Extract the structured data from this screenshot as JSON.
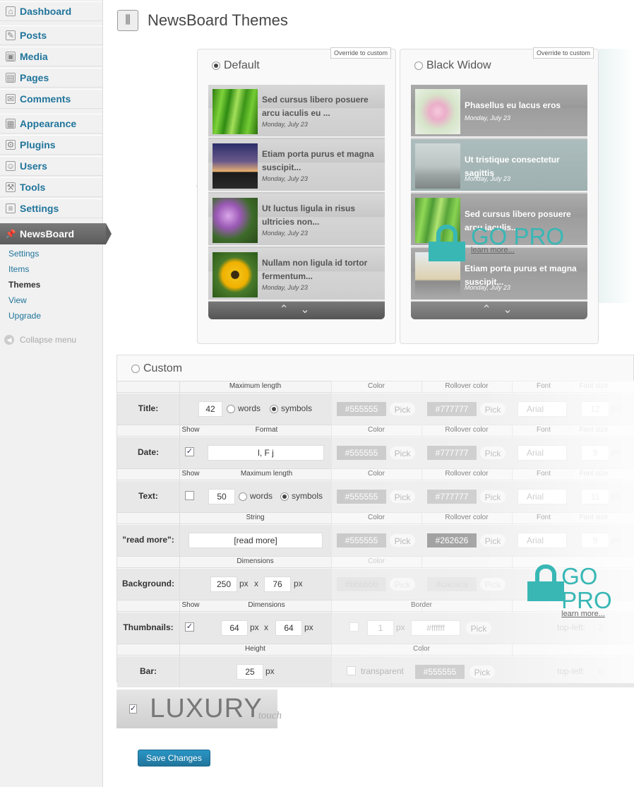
{
  "sidebar": {
    "menu": [
      {
        "label": "Dashboard",
        "icon": "dashboard-icon",
        "glyph": "⌂"
      },
      {
        "label": "Posts",
        "icon": "pin-icon",
        "glyph": "✎"
      },
      {
        "label": "Media",
        "icon": "media-icon",
        "glyph": "▣"
      },
      {
        "label": "Pages",
        "icon": "pages-icon",
        "glyph": "▤"
      },
      {
        "label": "Comments",
        "icon": "comment-icon",
        "glyph": "✉"
      },
      {
        "label": "Appearance",
        "icon": "appearance-icon",
        "glyph": "▦"
      },
      {
        "label": "Plugins",
        "icon": "plugin-icon",
        "glyph": "⚙"
      },
      {
        "label": "Users",
        "icon": "users-icon",
        "glyph": "☺"
      },
      {
        "label": "Tools",
        "icon": "tools-icon",
        "glyph": "⚒"
      },
      {
        "label": "Settings",
        "icon": "settings-icon",
        "glyph": "≡"
      },
      {
        "label": "NewsBoard",
        "icon": "newsboard-pin-icon",
        "glyph": "📌"
      }
    ],
    "submenu": [
      "Settings",
      "Items",
      "Themes",
      "View",
      "Upgrade"
    ],
    "current": "Themes",
    "collapse": "Collapse menu"
  },
  "header": {
    "title": "NewsBoard Themes"
  },
  "themes": [
    {
      "name": "Default",
      "override": "Override to custom",
      "selected": true,
      "items": [
        {
          "title": "Sed cursus libero posuere arcu iaculis eu ...",
          "date": "Monday, July 23"
        },
        {
          "title": "Etiam porta purus et magna suscipit...",
          "date": "Monday, July 23"
        },
        {
          "title": "Ut luctus ligula in risus ultricies non...",
          "date": "Monday, July 23"
        },
        {
          "title": "Nullam non ligula id tortor fermentum...",
          "date": "Monday, July 23"
        }
      ]
    },
    {
      "name": "Black Widow",
      "override": "Override to custom",
      "selected": false,
      "items": [
        {
          "title": "Phasellus eu lacus eros",
          "date": "Monday, July 23"
        },
        {
          "title": "Ut tristique consectetur sagittis",
          "date": "Monday, July 23"
        },
        {
          "title": "Sed cursus libero posuere arcu iaculis...",
          "date": ""
        },
        {
          "title": "Etiam porta purus et magna suscipit...",
          "date": "Monday, July 23"
        }
      ]
    }
  ],
  "gopro": {
    "title": "GO PRO",
    "link": "learn more..."
  },
  "bar_arrows": "⌃ ⌄",
  "custom": {
    "label": "Custom",
    "headers": {
      "max_length": "Maximum length",
      "color": "Color",
      "rollover": "Rollover color",
      "font": "Font",
      "font_size": "Font size",
      "show": "Show",
      "format": "Format",
      "string": "String",
      "dimensions": "Dimensions",
      "border": "Border",
      "height": "Height"
    },
    "title": {
      "label": "Title:",
      "length": "42",
      "words": "words",
      "symbols": "symbols",
      "color": "#555555",
      "rollover": "#777777",
      "font": "Arial",
      "size": "12",
      "px": "px"
    },
    "date": {
      "label": "Date:",
      "format": "l, F j",
      "color": "#555555",
      "rollover": "#777777",
      "font": "Arial",
      "size": "9"
    },
    "text": {
      "label": "Text:",
      "length": "50",
      "words": "words",
      "symbols": "symbols",
      "color": "#555555",
      "rollover": "#777777",
      "font": "Arial",
      "size": "11"
    },
    "readmore": {
      "label": "\"read more\":",
      "string": "[read more]",
      "color": "#555555",
      "rollover": "#262626",
      "font": "Arial",
      "size": "9"
    },
    "background": {
      "label": "Background:",
      "w": "250",
      "h": "76",
      "px": "px",
      "x": "x",
      "color": "#bbbbbb",
      "rollover": "#cacaca"
    },
    "thumbnails": {
      "label": "Thumbnails:",
      "w": "64",
      "h": "64",
      "border": "1",
      "border_color": "#ffffff",
      "topleft": "top-left:",
      "tl": "2"
    },
    "bar": {
      "label": "Bar:",
      "height": "25",
      "transparent": "transparent",
      "color": "#555555",
      "topleft": "top-left:",
      "tl": "0"
    },
    "pick": "Pick"
  },
  "luxury": {
    "main": "LUXURY",
    "sub": "touch"
  },
  "save": "Save Changes"
}
